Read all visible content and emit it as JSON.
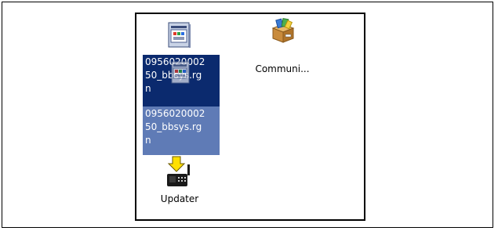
{
  "window": {
    "items": [
      {
        "label": "0956020002\n50_bbsys.rg\nn",
        "type": "rgn-file",
        "selected": true
      },
      {
        "label": "Communi...",
        "type": "communication-app",
        "selected": false
      },
      {
        "label": "0956020002\n50_bbsys.rg\nn",
        "type": "rgn-file-drag-ghost",
        "selected": true
      },
      {
        "label": "Updater",
        "type": "updater-app",
        "selected": false
      }
    ]
  },
  "colors": {
    "selection": "#0b2a6e",
    "drag_ghost": "#5f7bb6",
    "border": "#000000",
    "background": "#ffffff"
  }
}
